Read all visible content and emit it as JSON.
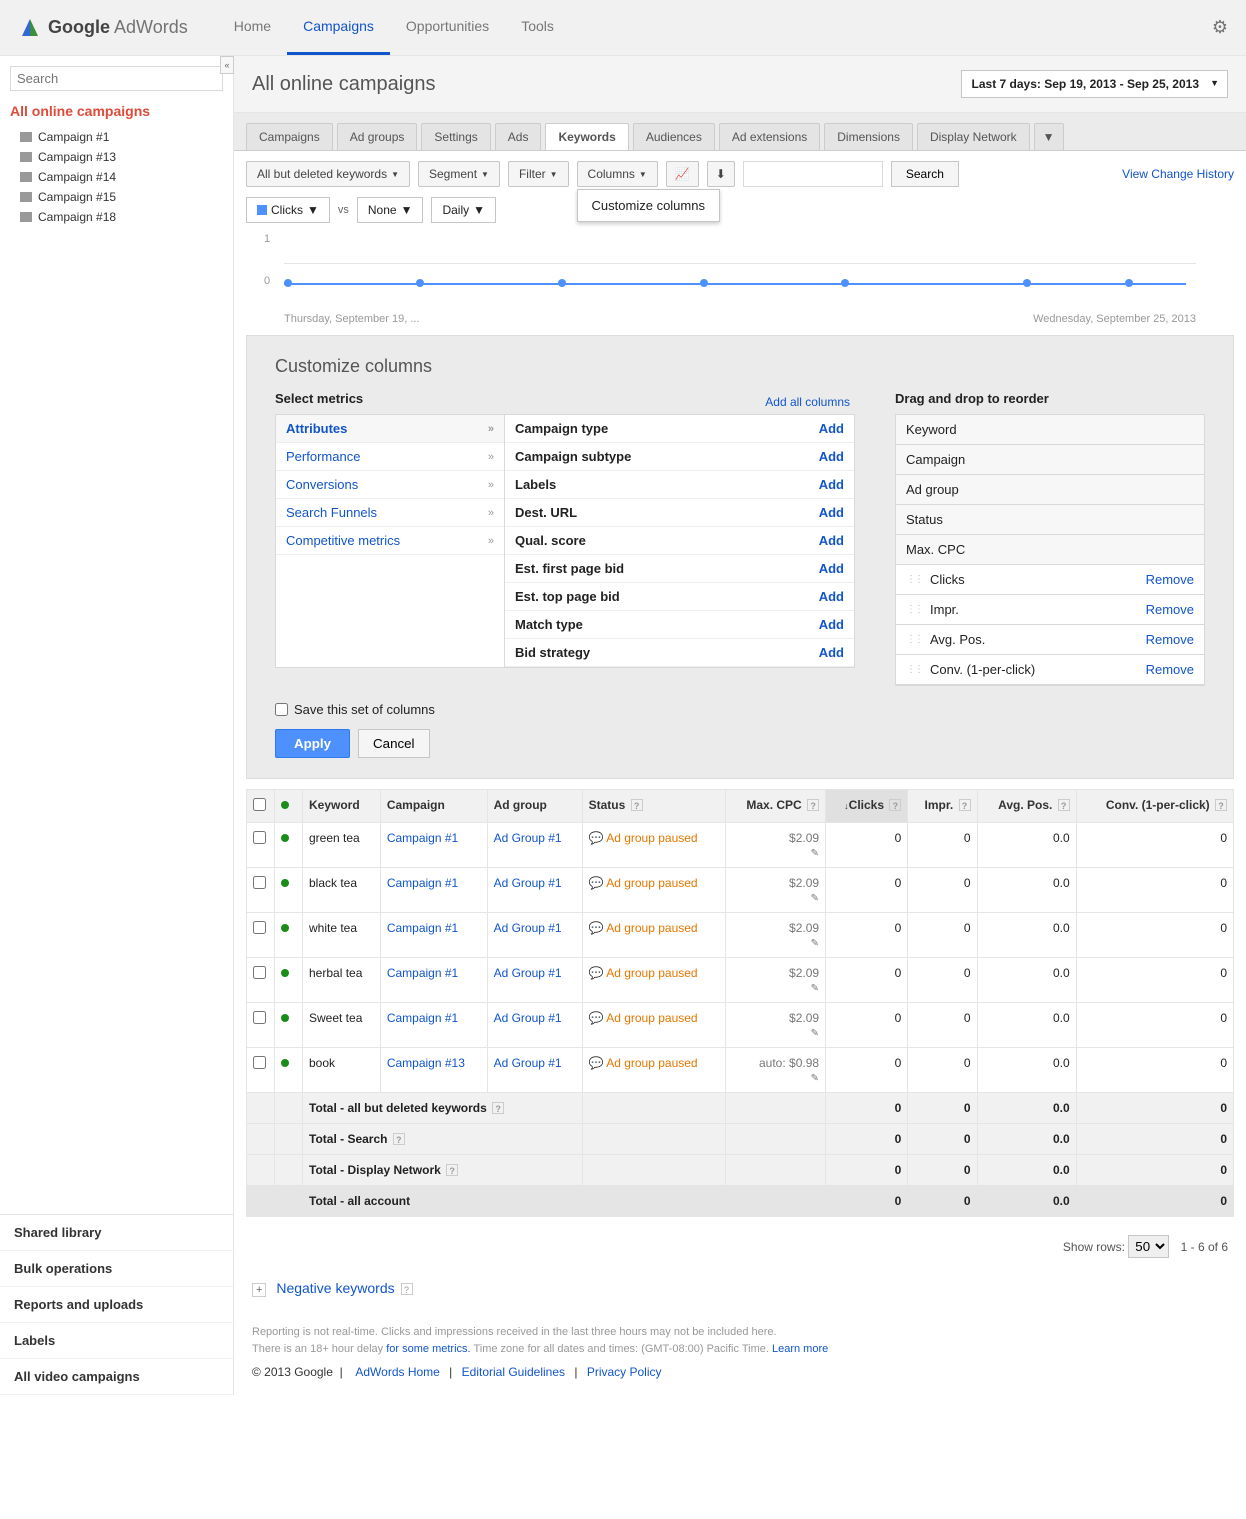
{
  "brand": {
    "google": "Google",
    "product": "AdWords"
  },
  "topnav": [
    "Home",
    "Campaigns",
    "Opportunities",
    "Tools"
  ],
  "topnav_active": 1,
  "search_placeholder": "Search",
  "tree_root": "All online campaigns",
  "campaigns": [
    "Campaign #1",
    "Campaign #13",
    "Campaign #14",
    "Campaign #15",
    "Campaign #18"
  ],
  "sidebar_bottom": [
    "Shared library",
    "Bulk operations",
    "Reports and uploads",
    "Labels",
    "All video campaigns"
  ],
  "page_title": "All online campaigns",
  "date_range": "Last 7 days: Sep 19, 2013 - Sep 25, 2013",
  "tabs": [
    "Campaigns",
    "Ad groups",
    "Settings",
    "Ads",
    "Keywords",
    "Audiences",
    "Ad extensions",
    "Dimensions",
    "Display Network"
  ],
  "tabs_active": 4,
  "toolbar": {
    "filter1": "All but deleted keywords",
    "segment": "Segment",
    "filter": "Filter",
    "columns": "Columns",
    "search": "Search"
  },
  "popup": "Customize columns",
  "toolbar2": {
    "clicks": "Clicks",
    "vs": "vs",
    "none": "None",
    "daily": "Daily"
  },
  "change_history": "View Change History",
  "chart": {
    "y0": "0",
    "y1": "1",
    "xstart": "Thursday, September 19, ...",
    "xend": "Wednesday, September 25, 2013"
  },
  "customize": {
    "title": "Customize columns",
    "select_metrics": "Select metrics",
    "reorder": "Drag and drop to reorder",
    "add_all": "Add all columns",
    "categories": [
      "Attributes",
      "Performance",
      "Conversions",
      "Search Funnels",
      "Competitive metrics"
    ],
    "attrs": [
      {
        "label": "Campaign type",
        "action": "Add"
      },
      {
        "label": "Campaign subtype",
        "action": "Add"
      },
      {
        "label": "Labels",
        "action": "Add"
      },
      {
        "label": "Dest. URL",
        "action": "Add"
      },
      {
        "label": "Qual. score",
        "action": "Add"
      },
      {
        "label": "Est. first page bid",
        "action": "Add"
      },
      {
        "label": "Est. top page bid",
        "action": "Add"
      },
      {
        "label": "Match type",
        "action": "Add"
      },
      {
        "label": "Bid strategy",
        "action": "Add"
      }
    ],
    "fixed_cols": [
      "Keyword",
      "Campaign",
      "Ad group",
      "Status",
      "Max. CPC"
    ],
    "draggable": [
      {
        "label": "Clicks",
        "remove": "Remove"
      },
      {
        "label": "Impr.",
        "remove": "Remove"
      },
      {
        "label": "Avg. Pos.",
        "remove": "Remove"
      },
      {
        "label": "Conv. (1-per-click)",
        "remove": "Remove"
      }
    ],
    "save_label": "Save this set of columns",
    "apply": "Apply",
    "cancel": "Cancel"
  },
  "headers": [
    "Keyword",
    "Campaign",
    "Ad group",
    "Status",
    "Max. CPC",
    "Clicks",
    "Impr.",
    "Avg. Pos.",
    "Conv. (1-per-click)"
  ],
  "rows": [
    {
      "kw": "green tea",
      "camp": "Campaign #1",
      "ag": "Ad Group #1",
      "status": "Ad group paused",
      "cpc": "$2.09",
      "clicks": "0",
      "impr": "0",
      "pos": "0.0",
      "conv": "0"
    },
    {
      "kw": "black tea",
      "camp": "Campaign #1",
      "ag": "Ad Group #1",
      "status": "Ad group paused",
      "cpc": "$2.09",
      "clicks": "0",
      "impr": "0",
      "pos": "0.0",
      "conv": "0"
    },
    {
      "kw": "white tea",
      "camp": "Campaign #1",
      "ag": "Ad Group #1",
      "status": "Ad group paused",
      "cpc": "$2.09",
      "clicks": "0",
      "impr": "0",
      "pos": "0.0",
      "conv": "0"
    },
    {
      "kw": "herbal tea",
      "camp": "Campaign #1",
      "ag": "Ad Group #1",
      "status": "Ad group paused",
      "cpc": "$2.09",
      "clicks": "0",
      "impr": "0",
      "pos": "0.0",
      "conv": "0"
    },
    {
      "kw": "Sweet tea",
      "camp": "Campaign #1",
      "ag": "Ad Group #1",
      "status": "Ad group paused",
      "cpc": "$2.09",
      "clicks": "0",
      "impr": "0",
      "pos": "0.0",
      "conv": "0"
    },
    {
      "kw": "book",
      "camp": "Campaign #13",
      "ag": "Ad Group #1",
      "status": "Ad group paused",
      "cpc": "auto: $0.98",
      "clicks": "0",
      "impr": "0",
      "pos": "0.0",
      "conv": "0"
    }
  ],
  "totals": [
    {
      "label": "Total - all but deleted keywords",
      "clicks": "0",
      "impr": "0",
      "pos": "0.0",
      "conv": "0"
    },
    {
      "label": "Total - Search",
      "clicks": "0",
      "impr": "0",
      "pos": "0.0",
      "conv": "0"
    },
    {
      "label": "Total - Display Network",
      "clicks": "0",
      "impr": "0",
      "pos": "0.0",
      "conv": "0"
    }
  ],
  "grand": {
    "label": "Total - all account",
    "clicks": "0",
    "impr": "0",
    "pos": "0.0",
    "conv": "0"
  },
  "pager": {
    "show": "Show rows:",
    "val": "50",
    "range": "1 - 6 of 6"
  },
  "neg": "Negative keywords",
  "footer": {
    "l1": "Reporting is not real-time. Clicks and impressions received in the last three hours may not be included here.",
    "l2a": "There is an 18+ hour delay ",
    "l2link": "for some metrics.",
    "l2b": " Time zone for all dates and times: (GMT-08:00) Pacific Time. ",
    "learn": "Learn more",
    "copy": "© 2013 Google",
    "links": [
      "AdWords Home",
      "Editorial Guidelines",
      "Privacy Policy"
    ]
  }
}
